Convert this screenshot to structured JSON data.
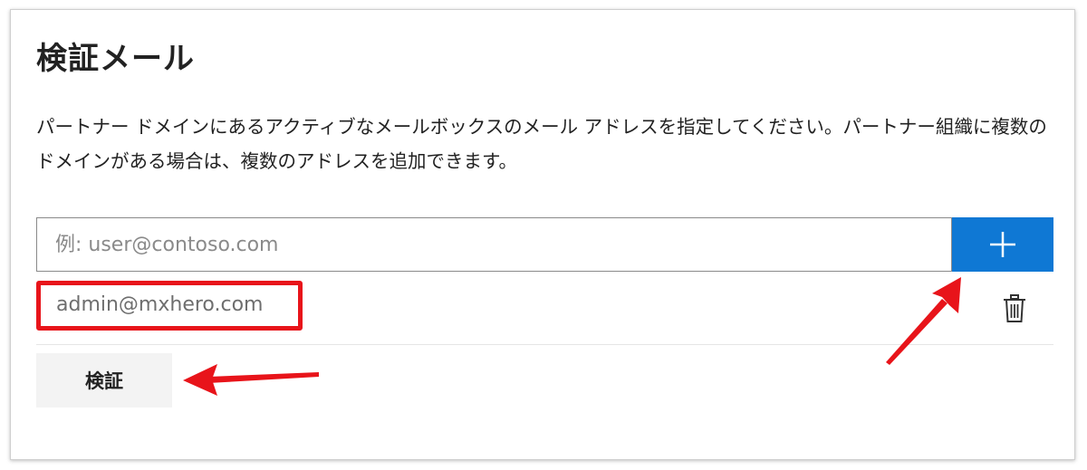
{
  "section": {
    "title": "検証メール",
    "description": "パートナー ドメインにあるアクティブなメールボックスのメール アドレスを指定してください。パートナー組織に複数のドメインがある場合は、複数のアドレスを追加できます。"
  },
  "email_input": {
    "placeholder": "例: user@contoso.com",
    "value": ""
  },
  "add_button": {
    "icon": "plus-icon",
    "color": "#0f78d4"
  },
  "email_list": [
    {
      "address": "admin@mxhero.com",
      "delete_icon": "trash-icon"
    }
  ],
  "verify_button": {
    "label": "検証"
  },
  "annotations": {
    "color": "#e8141a",
    "highlight": "email-list-item",
    "arrows": [
      "arrow-to-add-button",
      "arrow-to-verify-button"
    ]
  }
}
